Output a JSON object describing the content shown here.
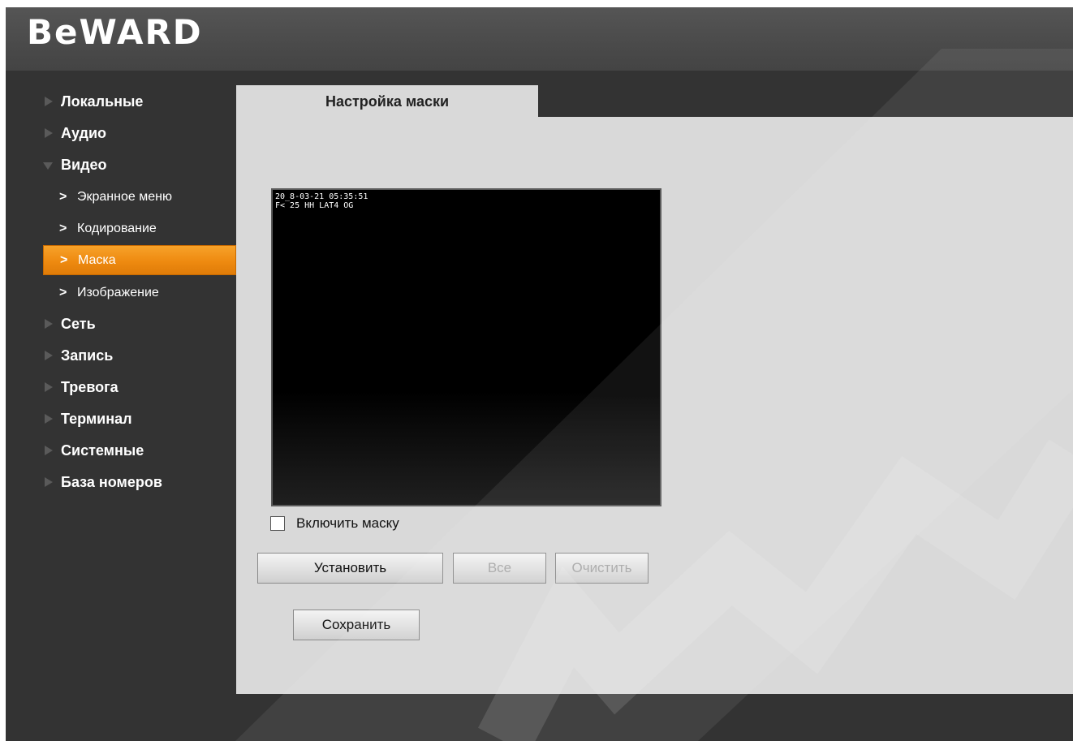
{
  "header": {
    "logo_text": "BeWARD"
  },
  "sidebar": {
    "items": [
      {
        "label": "Локальные",
        "expanded": false
      },
      {
        "label": "Аудио",
        "expanded": false
      },
      {
        "label": "Видео",
        "expanded": true,
        "children": [
          {
            "label": "Экранное меню",
            "active": false
          },
          {
            "label": "Кодирование",
            "active": false
          },
          {
            "label": "Маска",
            "active": true
          },
          {
            "label": "Изображение",
            "active": false
          }
        ]
      },
      {
        "label": "Сеть",
        "expanded": false
      },
      {
        "label": "Запись",
        "expanded": false
      },
      {
        "label": "Тревога",
        "expanded": false
      },
      {
        "label": "Терминал",
        "expanded": false
      },
      {
        "label": "Системные",
        "expanded": false
      },
      {
        "label": "База номеров",
        "expanded": false
      }
    ]
  },
  "main": {
    "tab_label": "Настройка маски",
    "video": {
      "osd_line1": "20_8-03-21 05:35:51",
      "osd_line2": "F< 25 HH LAT4 OG"
    },
    "enable_mask": {
      "label": "Включить маску",
      "checked": false
    },
    "buttons": {
      "set": "Установить",
      "all": "Все",
      "clear": "Очистить",
      "save": "Сохранить"
    }
  },
  "colors": {
    "accent": "#EE8A10",
    "background": "#333333",
    "panel": "#D9D9D9"
  },
  "icons": {
    "collapsed": "triangle-right-icon",
    "expanded": "triangle-down-icon",
    "submenu": "chevron-right-icon"
  }
}
